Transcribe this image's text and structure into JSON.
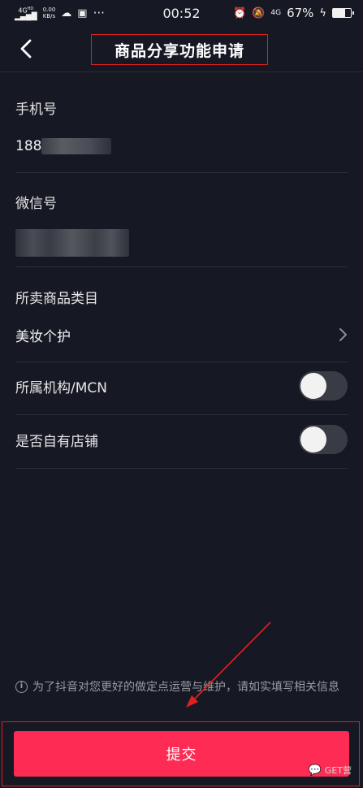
{
  "status_bar": {
    "network": "4G",
    "network_sup": "HD",
    "speed_value": "0.00",
    "speed_unit": "KB/s",
    "more": "···",
    "time": "00:52",
    "network_right": "4G",
    "battery": "67%",
    "battery_level": 0.67
  },
  "header": {
    "title": "商品分享功能申请"
  },
  "form": {
    "phone": {
      "label": "手机号",
      "value": "188"
    },
    "wechat": {
      "label": "微信号",
      "value": ""
    },
    "category": {
      "label": "所卖商品类目",
      "value": "美妆个护"
    },
    "mcn": {
      "label": "所属机构/MCN",
      "enabled": false
    },
    "own_store": {
      "label": "是否自有店铺",
      "enabled": false
    }
  },
  "notice": {
    "text": "为了抖音对您更好的做定点运营与维护，请如实填写相关信息"
  },
  "submit": {
    "label": "提交"
  },
  "watermark": {
    "text": "GET营"
  },
  "colors": {
    "background": "#161823",
    "accent": "#fe2c55",
    "annotation": "#e02020"
  }
}
